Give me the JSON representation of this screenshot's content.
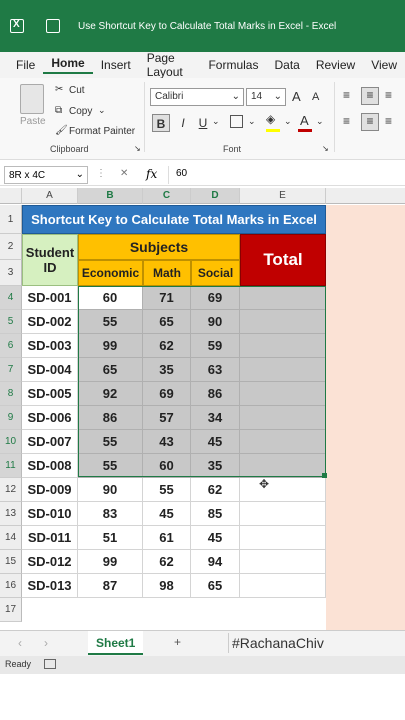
{
  "window": {
    "title": "Use Shortcut Key to Calculate Total Marks in Excel  -  Excel"
  },
  "tabs": [
    "File",
    "Home",
    "Insert",
    "Page Layout",
    "Formulas",
    "Data",
    "Review",
    "View"
  ],
  "ribbon": {
    "paste": "Paste",
    "cut": "Cut",
    "copy": "Copy",
    "format_painter": "Format Painter",
    "clipboard_group": "Clipboard",
    "font_name": "Calibri",
    "font_size": "14",
    "font_group": "Font",
    "bold": "B",
    "italic": "I",
    "underline": "U",
    "grow_font": "A",
    "shrink_font": "A"
  },
  "formula_bar": {
    "name_box": "8R x 4C",
    "fx": "fx",
    "value": "60"
  },
  "columns": [
    "A",
    "B",
    "C",
    "D",
    "E"
  ],
  "sheet": {
    "title": "Shortcut Key to Calculate Total Marks in Excel",
    "student_id": "Student ID",
    "subjects": "Subjects",
    "total": "Total",
    "subject_headers": [
      "Economic",
      "Math",
      "Social"
    ],
    "rows": [
      {
        "id": "SD-001",
        "economic": "60",
        "math": "71",
        "social": "69"
      },
      {
        "id": "SD-002",
        "economic": "55",
        "math": "65",
        "social": "90"
      },
      {
        "id": "SD-003",
        "economic": "99",
        "math": "62",
        "social": "59"
      },
      {
        "id": "SD-004",
        "economic": "65",
        "math": "35",
        "social": "63"
      },
      {
        "id": "SD-005",
        "economic": "92",
        "math": "69",
        "social": "86"
      },
      {
        "id": "SD-006",
        "economic": "86",
        "math": "57",
        "social": "34"
      },
      {
        "id": "SD-007",
        "economic": "55",
        "math": "43",
        "social": "45"
      },
      {
        "id": "SD-008",
        "economic": "55",
        "math": "60",
        "social": "35"
      },
      {
        "id": "SD-009",
        "economic": "90",
        "math": "55",
        "social": "62"
      },
      {
        "id": "SD-010",
        "economic": "83",
        "math": "45",
        "social": "85"
      },
      {
        "id": "SD-011",
        "economic": "51",
        "math": "61",
        "social": "45"
      },
      {
        "id": "SD-012",
        "economic": "99",
        "math": "62",
        "social": "94"
      },
      {
        "id": "SD-013",
        "economic": "87",
        "math": "98",
        "social": "65"
      }
    ],
    "row_numbers": [
      "1",
      "2",
      "3",
      "4",
      "5",
      "6",
      "7",
      "8",
      "9",
      "10",
      "11",
      "12",
      "13",
      "14",
      "15",
      "16",
      "17"
    ]
  },
  "footer": {
    "sheet_tab": "Sheet1",
    "add": "+",
    "hashtag": "#RachanaChiv"
  },
  "status": {
    "ready": "Ready"
  },
  "colors": {
    "excel_green": "#1f7a45",
    "title_blue": "#2f77c0",
    "subjects_yellow": "#ffc000",
    "total_red": "#c00000",
    "id_green": "#d6f0c0",
    "selection_gray": "#c8c8c8",
    "peach": "#fbe2d5"
  }
}
